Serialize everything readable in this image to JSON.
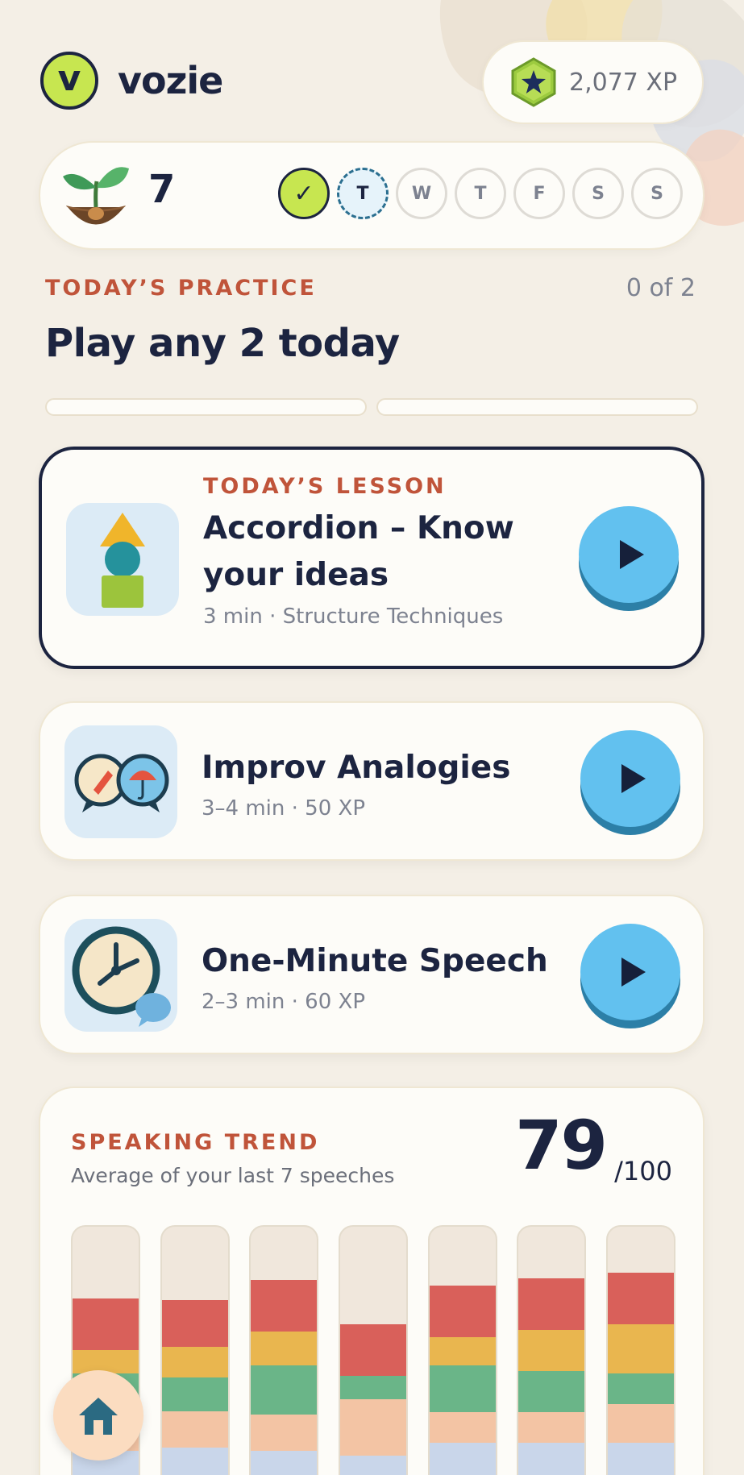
{
  "app": {
    "name": "vozie",
    "logo_letter": "v"
  },
  "xp": {
    "value": "2,077 XP",
    "icon": "star-hexagon-icon"
  },
  "streak": {
    "count": "7",
    "icon": "sprout-icon",
    "days": [
      {
        "label": "✓",
        "state": "done"
      },
      {
        "label": "T",
        "state": "today"
      },
      {
        "label": "W",
        "state": "upcoming"
      },
      {
        "label": "T",
        "state": "upcoming"
      },
      {
        "label": "F",
        "state": "upcoming"
      },
      {
        "label": "S",
        "state": "upcoming"
      },
      {
        "label": "S",
        "state": "upcoming"
      }
    ]
  },
  "practice": {
    "label": "TODAY’S PRACTICE",
    "count": "0 of 2",
    "title": "Play any 2 today",
    "progress": [
      0,
      0
    ]
  },
  "cards": [
    {
      "eyebrow": "TODAY’S LESSON",
      "title_line1": "Accordion – Know",
      "title_line2": "your ideas",
      "meta": "3 min · Structure Techniques",
      "icon": "shape-stack-icon"
    },
    {
      "title": "Improv Analogies",
      "meta": "3–4 min · 50 XP",
      "icon": "speech-bubbles-rocket-umbrella-icon"
    },
    {
      "title": "One-Minute Speech",
      "meta": "2–3 min · 60 XP",
      "icon": "clock-speech-icon"
    }
  ],
  "trend": {
    "label": "SPEAKING TREND",
    "subtitle": "Average of your last 7 speeches",
    "score": "79",
    "max": "/100",
    "colors": [
      "#d9605a",
      "#e9b64f",
      "#6ab588",
      "#f3c4a4",
      "#c9d6ea"
    ],
    "bars": [
      [
        0.2,
        0.09,
        0.13,
        0.17,
        0.12
      ],
      [
        0.18,
        0.12,
        0.13,
        0.14,
        0.13
      ],
      [
        0.2,
        0.13,
        0.19,
        0.14,
        0.12
      ],
      [
        0.2,
        0.0,
        0.09,
        0.22,
        0.1
      ],
      [
        0.2,
        0.11,
        0.18,
        0.12,
        0.15
      ],
      [
        0.2,
        0.16,
        0.16,
        0.12,
        0.15
      ],
      [
        0.2,
        0.19,
        0.12,
        0.15,
        0.15
      ]
    ]
  },
  "nav": {
    "home_icon": "home-icon"
  }
}
